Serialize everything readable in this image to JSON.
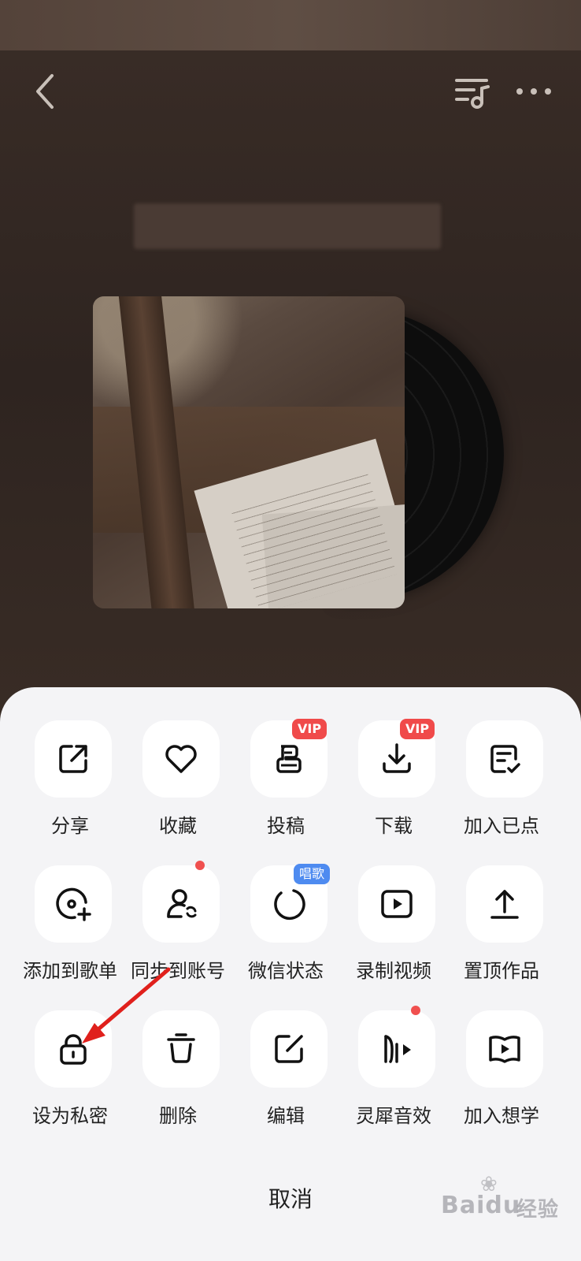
{
  "player": {
    "back_icon": "chevron-left-icon",
    "queue_icon": "playlist-music-icon",
    "more_icon": "more-dots-icon"
  },
  "sheet": {
    "rows": [
      [
        {
          "label": "分享",
          "icon": "share-icon"
        },
        {
          "label": "收藏",
          "icon": "heart-icon"
        },
        {
          "label": "投稿",
          "icon": "submit-icon",
          "badge": "VIP"
        },
        {
          "label": "下载",
          "icon": "download-icon",
          "badge": "VIP"
        },
        {
          "label": "加入已点",
          "icon": "queue-check-icon"
        }
      ],
      [
        {
          "label": "添加到歌单",
          "icon": "add-playlist-icon"
        },
        {
          "label": "同步到账号",
          "icon": "sync-account-icon"
        },
        {
          "label": "微信状态",
          "icon": "circle-status-icon",
          "badge": "唱歌"
        },
        {
          "label": "录制视频",
          "icon": "video-icon"
        },
        {
          "label": "置顶作品",
          "icon": "pin-top-icon"
        }
      ],
      [
        {
          "label": "设为私密",
          "icon": "lock-icon"
        },
        {
          "label": "删除",
          "icon": "trash-icon"
        },
        {
          "label": "编辑",
          "icon": "edit-icon"
        },
        {
          "label": "灵犀音效",
          "icon": "sound-effect-icon"
        },
        {
          "label": "加入想学",
          "icon": "book-play-icon"
        }
      ]
    ],
    "cancel_label": "取消"
  },
  "watermark": {
    "brand": "Bai",
    "brand2": "du",
    "suffix": "经验"
  },
  "colors": {
    "vip_badge": "#f04a4a",
    "sing_badge": "#4e8bf0",
    "notify_dot": "#f0504f",
    "annotation_arrow": "#e0201c",
    "sheet_bg": "#f4f4f6"
  }
}
